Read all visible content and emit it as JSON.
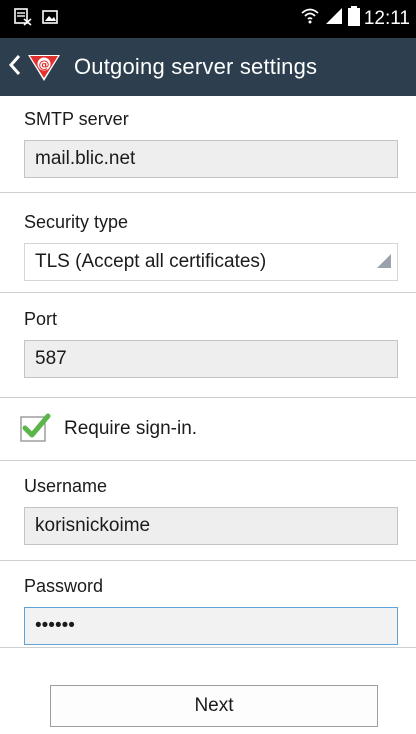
{
  "status_bar": {
    "time": "12:11"
  },
  "header": {
    "title": "Outgoing server settings"
  },
  "form": {
    "smtp_server": {
      "label": "SMTP server",
      "value": "mail.blic.net"
    },
    "security_type": {
      "label": "Security type",
      "value": "TLS (Accept all certificates)"
    },
    "port": {
      "label": "Port",
      "value": "587"
    },
    "require_signin": {
      "label": "Require sign-in.",
      "checked": true
    },
    "username": {
      "label": "Username",
      "value": "korisnickoime"
    },
    "password": {
      "label": "Password",
      "value": "••••••"
    }
  },
  "buttons": {
    "next_label": "Next"
  },
  "colors": {
    "action_bar": "#2d3f4f",
    "checkmark": "#5ab54a",
    "focus_border": "#5fa3d9"
  }
}
